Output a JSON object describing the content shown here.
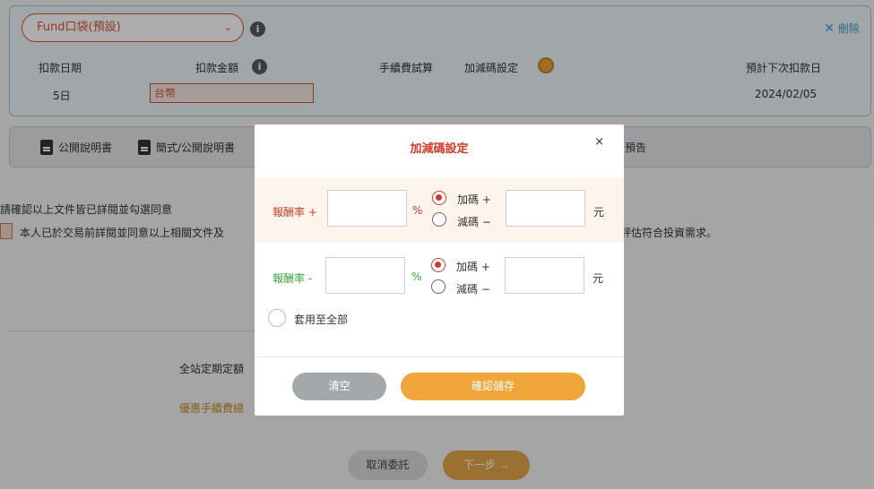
{
  "fund_card": {
    "fund_select": "Fund口袋(預設)",
    "delete_label": "刪除",
    "debit_date_label": "扣款日期",
    "debit_amount_label": "扣款金額",
    "fee_calc_label": "手續費試算",
    "adjust_setting_label": "加減碼設定",
    "next_debit_label": "預計下次扣款日",
    "debit_date_value": "5日",
    "currency": "台幣",
    "next_debit_value": "2024/02/05"
  },
  "documents": {
    "public_prospectus": "公開說明書",
    "simplified_prospectus": "簡式/公開說明書",
    "notice_tail": "預告"
  },
  "confirm": {
    "instruction": "請確認以上文件皆已詳閱並勾選同意",
    "agree_text": "本人已於交易前詳閱並同意以上相關文件及",
    "agree_tail": "評估符合投資需求。"
  },
  "fees": {
    "sitewide_label": "全站定期定額",
    "promo_label": "優惠手續費總"
  },
  "footer": {
    "cancel_label": "取消委託",
    "next_label": "下一步 →"
  },
  "modal": {
    "title": "加減碼設定",
    "close": "×",
    "plus_row": {
      "rate_label": "報酬率 +",
      "pct": "%",
      "increase": "加碼 +",
      "decrease": "減碼 −",
      "unit": "元",
      "selected": "increase",
      "color": "#d43a2a"
    },
    "minus_row": {
      "rate_label": "報酬率 -",
      "pct": "%",
      "increase": "加碼 +",
      "decrease": "減碼 −",
      "unit": "元",
      "selected": "increase",
      "color": "#3aa63a"
    },
    "apply_all": "套用至全部",
    "clear_label": "清空",
    "save_label": "確認儲存"
  },
  "colors": {
    "accent_red": "#d43a2a",
    "accent_orange": "#f0a63a",
    "link_blue": "#3aa0c8"
  }
}
